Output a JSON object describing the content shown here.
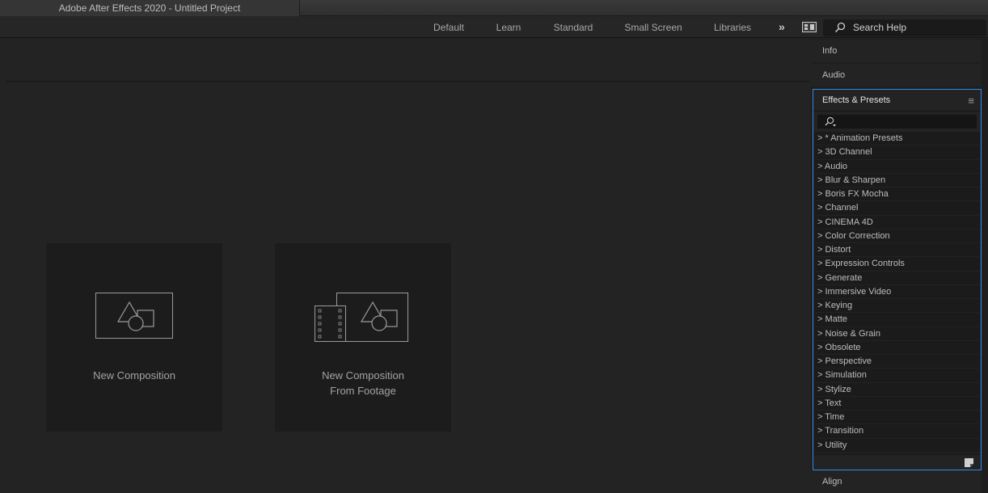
{
  "window": {
    "title": "Adobe After Effects 2020 - Untitled Project"
  },
  "workspaces": {
    "tabs": [
      {
        "label": "Default"
      },
      {
        "label": "Learn"
      },
      {
        "label": "Standard"
      },
      {
        "label": "Small Screen"
      },
      {
        "label": "Libraries"
      }
    ],
    "more_label": "»"
  },
  "search_help": {
    "label": "Search Help"
  },
  "home": {
    "new_composition": "New Composition",
    "new_comp_footage_line1": "New Composition",
    "new_comp_footage_line2": "From Footage"
  },
  "right_panels": {
    "info": "Info",
    "audio": "Audio",
    "align": "Align"
  },
  "effects_presets": {
    "title": "Effects & Presets",
    "menu_icon": "≡",
    "items": [
      "> * Animation Presets",
      "> 3D Channel",
      "> Audio",
      "> Blur & Sharpen",
      "> Boris FX Mocha",
      "> Channel",
      "> CINEMA 4D",
      "> Color Correction",
      "> Distort",
      "> Expression Controls",
      "> Generate",
      "> Immersive Video",
      "> Keying",
      "> Matte",
      "> Noise & Grain",
      "> Obsolete",
      "> Perspective",
      "> Simulation",
      "> Stylize",
      "> Text",
      "> Time",
      "> Transition",
      "> Utility"
    ]
  },
  "colors": {
    "accent_blue": "#2d8ceb",
    "background": "#232323",
    "card": "#1c1c1c"
  }
}
